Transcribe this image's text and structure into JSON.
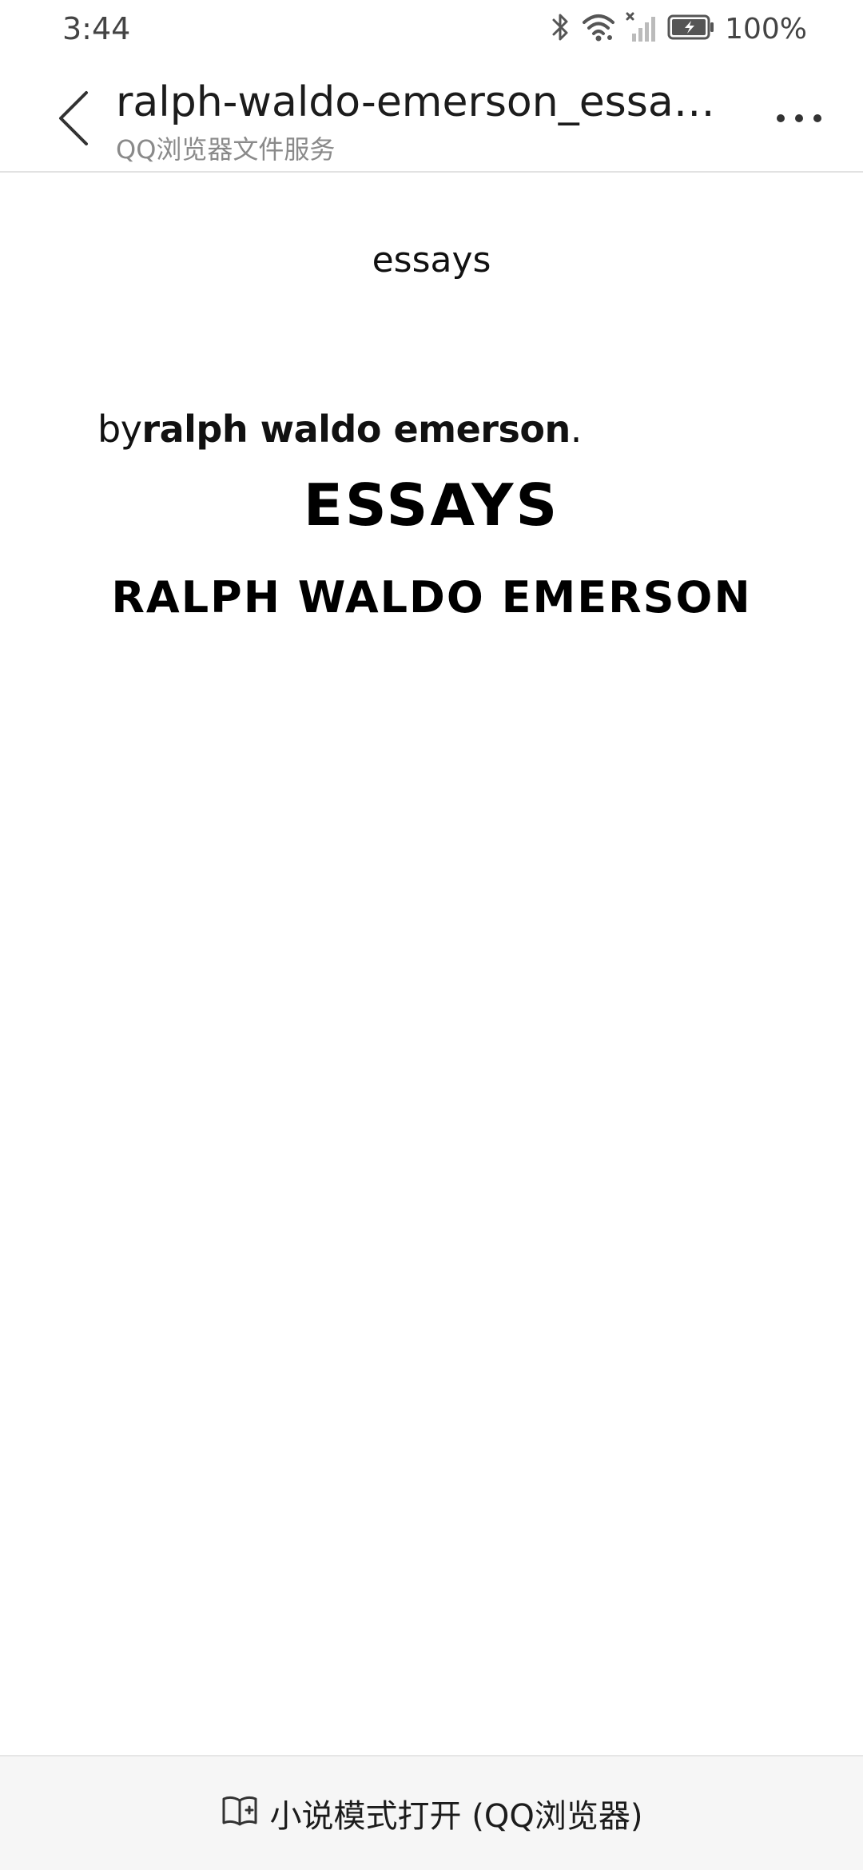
{
  "status_bar": {
    "time": "3:44",
    "battery": "100%"
  },
  "app_bar": {
    "title": "ralph-waldo-emerson_essays.pdf",
    "subtitle": "QQ浏览器文件服务"
  },
  "document": {
    "header": "essays",
    "byline_prefix": "by",
    "byline_author": "ralph waldo emerson",
    "byline_suffix": ".",
    "title": "ESSAYS",
    "author": "RALPH WALDO EMERSON"
  },
  "bottom_bar": {
    "label": "小说模式打开 (QQ浏览器)"
  },
  "icons": {
    "back": "back-arrow-icon",
    "more": "more-dots-icon",
    "bluetooth": "bluetooth-icon",
    "wifi": "wifi-icon",
    "signal": "signal-icon",
    "battery": "battery-icon",
    "book": "book-icon"
  },
  "colors": {
    "text": "#111111",
    "subtitle": "#8a8a8a",
    "bottom_bar_bg": "#f6f6f6"
  }
}
